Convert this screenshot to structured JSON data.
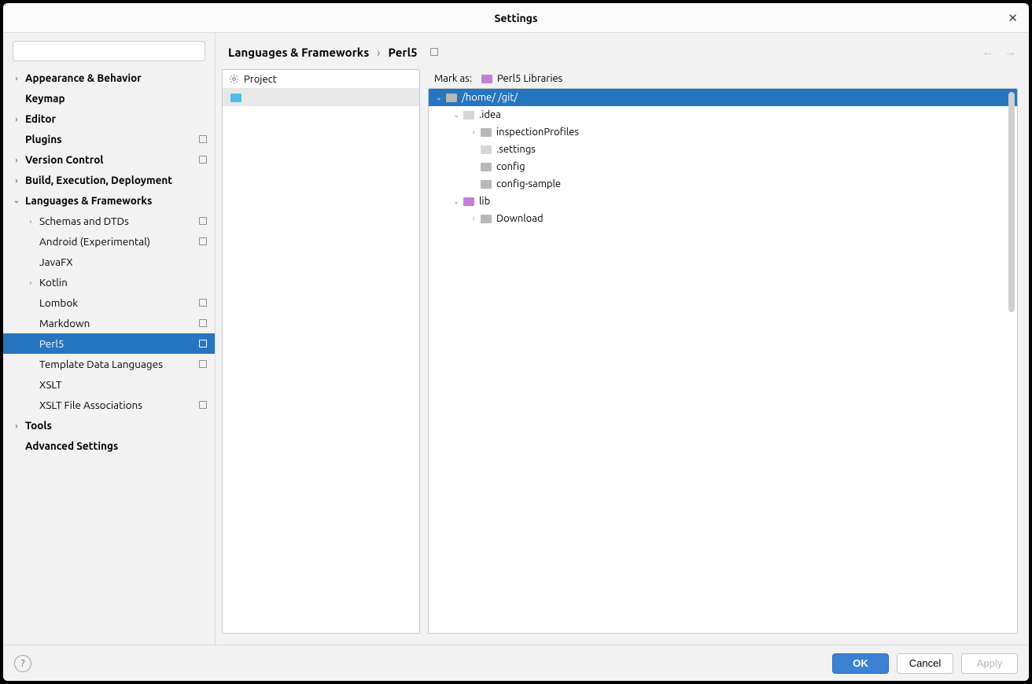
{
  "window": {
    "title": "Settings"
  },
  "search": {
    "placeholder": ""
  },
  "sidebar": [
    {
      "label": "Appearance & Behavior",
      "bold": true,
      "expandable": true,
      "indent": 0
    },
    {
      "label": "Keymap",
      "bold": true,
      "indent": 0
    },
    {
      "label": "Editor",
      "bold": true,
      "expandable": true,
      "indent": 0
    },
    {
      "label": "Plugins",
      "bold": true,
      "indent": 0,
      "badge": true
    },
    {
      "label": "Version Control",
      "bold": true,
      "expandable": true,
      "indent": 0,
      "badge": true
    },
    {
      "label": "Build, Execution, Deployment",
      "bold": true,
      "expandable": true,
      "indent": 0
    },
    {
      "label": "Languages & Frameworks",
      "bold": true,
      "expandable": true,
      "expanded": true,
      "indent": 0
    },
    {
      "label": "Schemas and DTDs",
      "expandable": true,
      "indent": 1,
      "badge": true
    },
    {
      "label": "Android (Experimental)",
      "indent": 1,
      "badge": true
    },
    {
      "label": "JavaFX",
      "indent": 1
    },
    {
      "label": "Kotlin",
      "expandable": true,
      "indent": 1
    },
    {
      "label": "Lombok",
      "indent": 1,
      "badge": true
    },
    {
      "label": "Markdown",
      "indent": 1,
      "badge": true
    },
    {
      "label": "Perl5",
      "indent": 1,
      "badge": true,
      "selected": true
    },
    {
      "label": "Template Data Languages",
      "indent": 1,
      "badge": true
    },
    {
      "label": "XSLT",
      "indent": 1
    },
    {
      "label": "XSLT File Associations",
      "indent": 1,
      "badge": true
    },
    {
      "label": "Tools",
      "bold": true,
      "expandable": true,
      "indent": 0
    },
    {
      "label": "Advanced Settings",
      "bold": true,
      "indent": 0
    }
  ],
  "breadcrumb": {
    "parent": "Languages & Frameworks",
    "current": "Perl5"
  },
  "project_panel": {
    "header": "Project",
    "items": [
      " "
    ]
  },
  "mark": {
    "label": "Mark as:",
    "lib_label": "Perl5 Libraries"
  },
  "dir_tree": [
    {
      "label": "/home/        /git/",
      "indent": 0,
      "arrow": "down",
      "folder": "grey",
      "hl": true
    },
    {
      "label": ".idea",
      "indent": 1,
      "arrow": "down",
      "folder": "dim"
    },
    {
      "label": "inspectionProfiles",
      "indent": 2,
      "arrow": "right",
      "folder": "grey"
    },
    {
      "label": ".settings",
      "indent": 2,
      "arrow": "",
      "folder": "dim"
    },
    {
      "label": "config",
      "indent": 2,
      "arrow": "",
      "folder": "grey"
    },
    {
      "label": "config-sample",
      "indent": 2,
      "arrow": "",
      "folder": "grey"
    },
    {
      "label": "lib",
      "indent": 1,
      "arrow": "down",
      "folder": "purple"
    },
    {
      "label": "Download",
      "indent": 2,
      "arrow": "right",
      "folder": "grey"
    }
  ],
  "buttons": {
    "ok": "OK",
    "cancel": "Cancel",
    "apply": "Apply"
  }
}
